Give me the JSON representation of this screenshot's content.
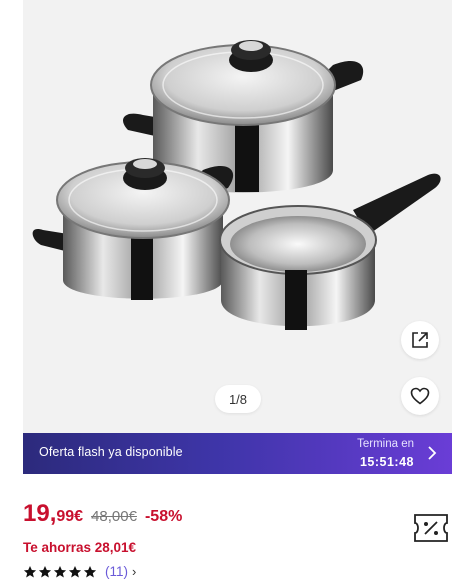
{
  "gallery": {
    "counter_text": "1/8",
    "share_icon": "external-link-icon",
    "favorite_icon": "heart-icon"
  },
  "flash": {
    "text": "Oferta flash ya disponible",
    "ends_label": "Termina en",
    "timer": "15:51:48",
    "chevron_icon": "chevron-right-icon"
  },
  "price": {
    "integer": "19,",
    "decimal": "99€",
    "old": "48,00€",
    "discount": "-58%",
    "savings": "Te ahorras 28,01€"
  },
  "rating": {
    "stars": 5,
    "count": "(11)",
    "chevron": "›"
  },
  "colors": {
    "price_red": "#c8102e",
    "banner_start": "#2c2a7c",
    "banner_end": "#6a3dd6",
    "link_purple": "#6a5ad8"
  },
  "coupon_icon": "discount-tag-icon"
}
